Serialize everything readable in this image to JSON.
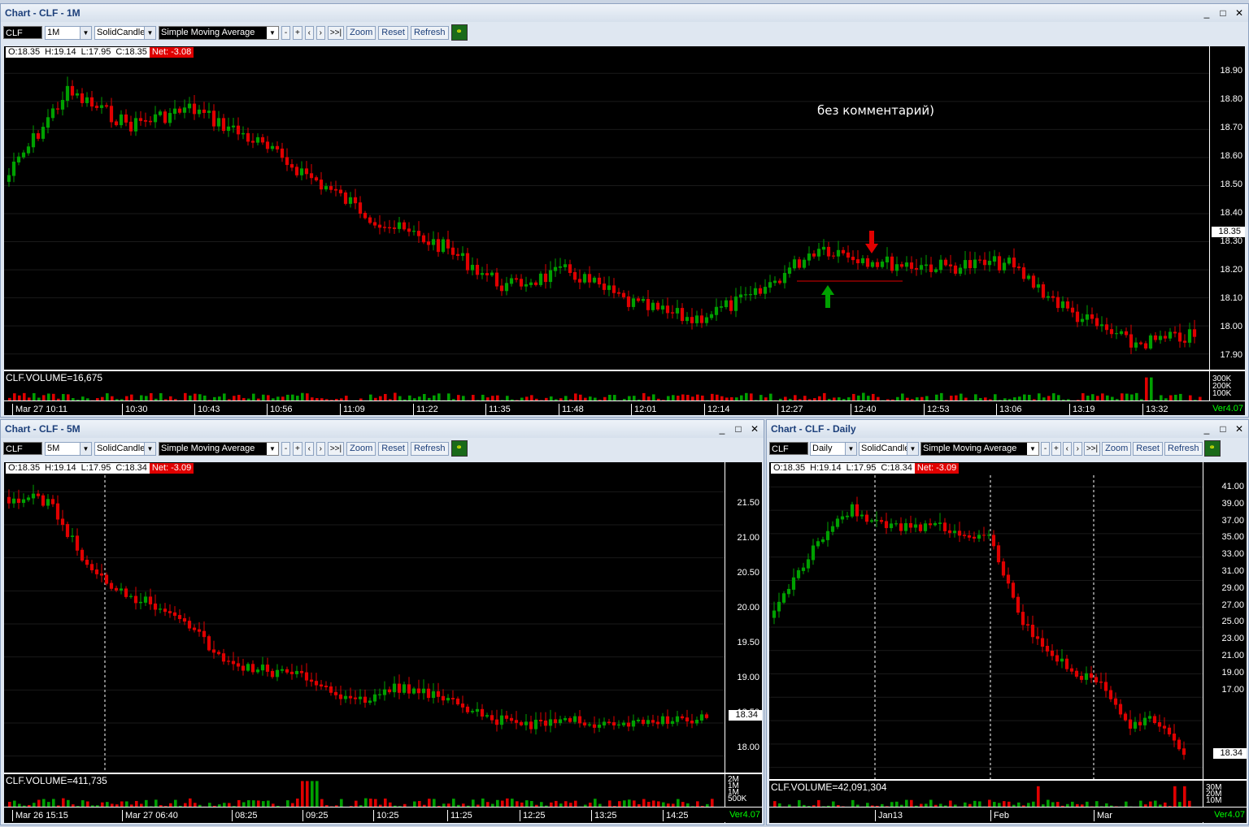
{
  "w1": {
    "title": "Chart - CLF - 1M",
    "symbol": "CLF",
    "interval": "1M",
    "style": "SolidCandle",
    "indicator": "Simple Moving Average",
    "btn_minus": "-",
    "btn_plus": "+",
    "btn_prev": "‹",
    "btn_next": "›",
    "btn_end": ">>|",
    "zoom": "Zoom",
    "reset": "Reset",
    "refresh": "Refresh",
    "o": "O:18.35",
    "h": "H:19.14",
    "l": "L:17.95",
    "c": "C:18.35",
    "net": "Net: -3.08",
    "price_tag": "18.35",
    "y_ticks": [
      "18.90",
      "18.80",
      "18.70",
      "18.60",
      "18.50",
      "18.40",
      "18.30",
      "18.20",
      "18.10",
      "18.00",
      "17.90"
    ],
    "volume_label": "CLF.VOLUME=16,675",
    "vol_ticks": [
      "300K",
      "200K",
      "100K"
    ],
    "x_ticks": [
      "Mar 27 10:11",
      "10:30",
      "10:43",
      "10:56",
      "11:09",
      "11:22",
      "11:35",
      "11:48",
      "12:01",
      "12:14",
      "12:27",
      "12:40",
      "12:53",
      "13:06",
      "13:19",
      "13:32"
    ],
    "version": "Ver4.07",
    "annotation": "без комментарий)"
  },
  "w2": {
    "title": "Chart - CLF - 5M",
    "symbol": "CLF",
    "interval": "5M",
    "style": "SolidCandle",
    "indicator": "Simple Moving Average",
    "btn_minus": "-",
    "btn_plus": "+",
    "btn_prev": "‹",
    "btn_next": "›",
    "btn_end": ">>|",
    "zoom": "Zoom",
    "reset": "Reset",
    "refresh": "Refresh",
    "o": "O:18.35",
    "h": "H:19.14",
    "l": "L:17.95",
    "c": "C:18.34",
    "net": "Net: -3.09",
    "price_tag": "18.34",
    "y_ticks": [
      "21.50",
      "21.00",
      "20.50",
      "20.00",
      "19.50",
      "19.00",
      "18.50",
      "18.00"
    ],
    "volume_label": "CLF.VOLUME=411,735",
    "vol_ticks": [
      "2M",
      "1M",
      "1M",
      "500K"
    ],
    "x_ticks": [
      "Mar 26 15:15",
      "Mar 27 06:40",
      "08:25",
      "09:25",
      "10:25",
      "11:25",
      "12:25",
      "13:25",
      "14:25"
    ],
    "version": "Ver4.07"
  },
  "w3": {
    "title": "Chart - CLF - Daily",
    "symbol": "CLF",
    "interval": "Daily",
    "style": "SolidCandle",
    "indicator": "Simple Moving Average",
    "btn_minus": "-",
    "btn_plus": "+",
    "btn_prev": "‹",
    "btn_next": "›",
    "btn_end": ">>|",
    "zoom": "Zoom",
    "reset": "Reset",
    "refresh": "Refresh",
    "o": "O:18.35",
    "h": "H:19.14",
    "l": "L:17.95",
    "c": "C:18.34",
    "net": "Net: -3.09",
    "price_tag": "18.34",
    "y_ticks": [
      "41.00",
      "39.00",
      "37.00",
      "35.00",
      "33.00",
      "31.00",
      "29.00",
      "27.00",
      "25.00",
      "23.00",
      "21.00",
      "19.00",
      "17.00"
    ],
    "volume_label": "CLF.VOLUME=42,091,304",
    "vol_ticks": [
      "30M",
      "20M",
      "10M"
    ],
    "x_ticks": [
      "Jan13",
      "Feb",
      "Mar"
    ],
    "version": "Ver4.07"
  },
  "window_controls": {
    "minimize": "_",
    "maximize": "□",
    "close": "✕"
  },
  "colors": {
    "up": "#00a000",
    "down": "#e00000",
    "background": "#000000",
    "axis": "#ffffff"
  }
}
